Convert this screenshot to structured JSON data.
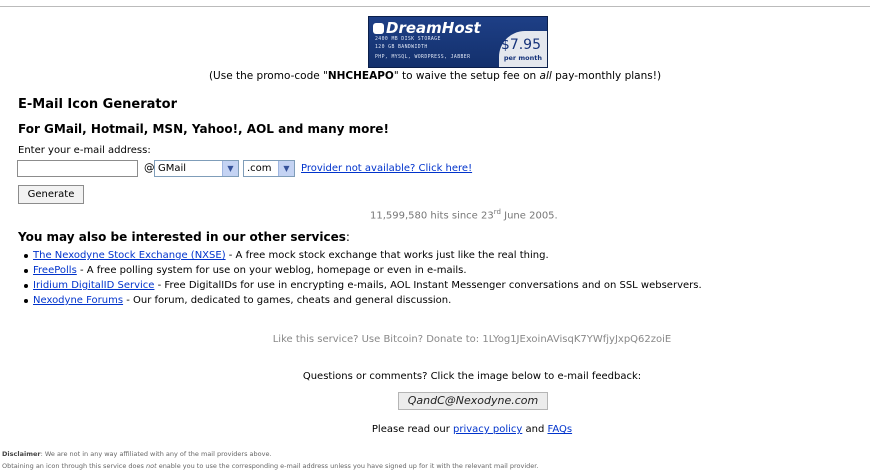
{
  "banner": {
    "brand": "DreamHost",
    "specs": [
      "2400 MB DISK STORAGE",
      "120 GB BANDWIDTH",
      "PHP, MYSQL, WORDPRESS, JABBER"
    ],
    "price": "$7.95",
    "per": "per month",
    "logo_icon": "dreamhost-moon-icon"
  },
  "promo": {
    "before": "(Use the promo-code \"",
    "code": "NHCHEAPO",
    "middle": "\" to waive the setup fee on ",
    "emph": "all",
    "after": " pay-monthly plans!)"
  },
  "heading": "E-Mail Icon Generator",
  "subheading": "For GMail, Hotmail, MSN, Yahoo!, AOL and many more!",
  "form": {
    "label": "Enter your e-mail address:",
    "email_value": "",
    "at": "@",
    "provider_selected": "GMail",
    "domain_selected": ".com",
    "not_available_link": "Provider not available? Click here!",
    "generate_label": "Generate"
  },
  "hits": {
    "text": "11,599,580 hits since 23",
    "sup": "rd",
    "after": " June 2005."
  },
  "services": {
    "heading": "You may also be interested in our other services",
    "colon": ":",
    "items": [
      {
        "link": "The Nexodyne Stock Exchange (NXSE)",
        "desc": " - A free mock stock exchange that works just like the real thing."
      },
      {
        "link": "FreePolls",
        "desc": " - A free polling system for use on your weblog, homepage or even in e-mails."
      },
      {
        "link": "Iridium DigitalID Service",
        "desc": " - Free DigitalIDs for use in encrypting e-mails, AOL Instant Messenger conversations and on SSL webservers."
      },
      {
        "link": "Nexodyne Forums",
        "desc": " - Our forum, dedicated to games, cheats and general discussion."
      }
    ]
  },
  "bitcoin": "Like this service? Use Bitcoin? Donate to: 1LYog1JExoinAVisqK7YWfjyJxpQ62zoiE",
  "questions": "Questions or comments? Click the image below to e-mail feedback:",
  "feedback_email": "QandC@Nexodyne.com",
  "privacy": {
    "before": "Please read our ",
    "link1": "privacy policy",
    "middle": " and ",
    "link2": "FAQs"
  },
  "disclaimer": {
    "label": "Disclaimer",
    "line1": ": We are not in any way affiliated with any of the mail providers above.",
    "line2_a": "Obtaining an icon through this service does ",
    "line2_emph": "not",
    "line2_b": " enable you to use the corresponding e-mail address unless you have signed up for it with the relevant mail provider."
  }
}
